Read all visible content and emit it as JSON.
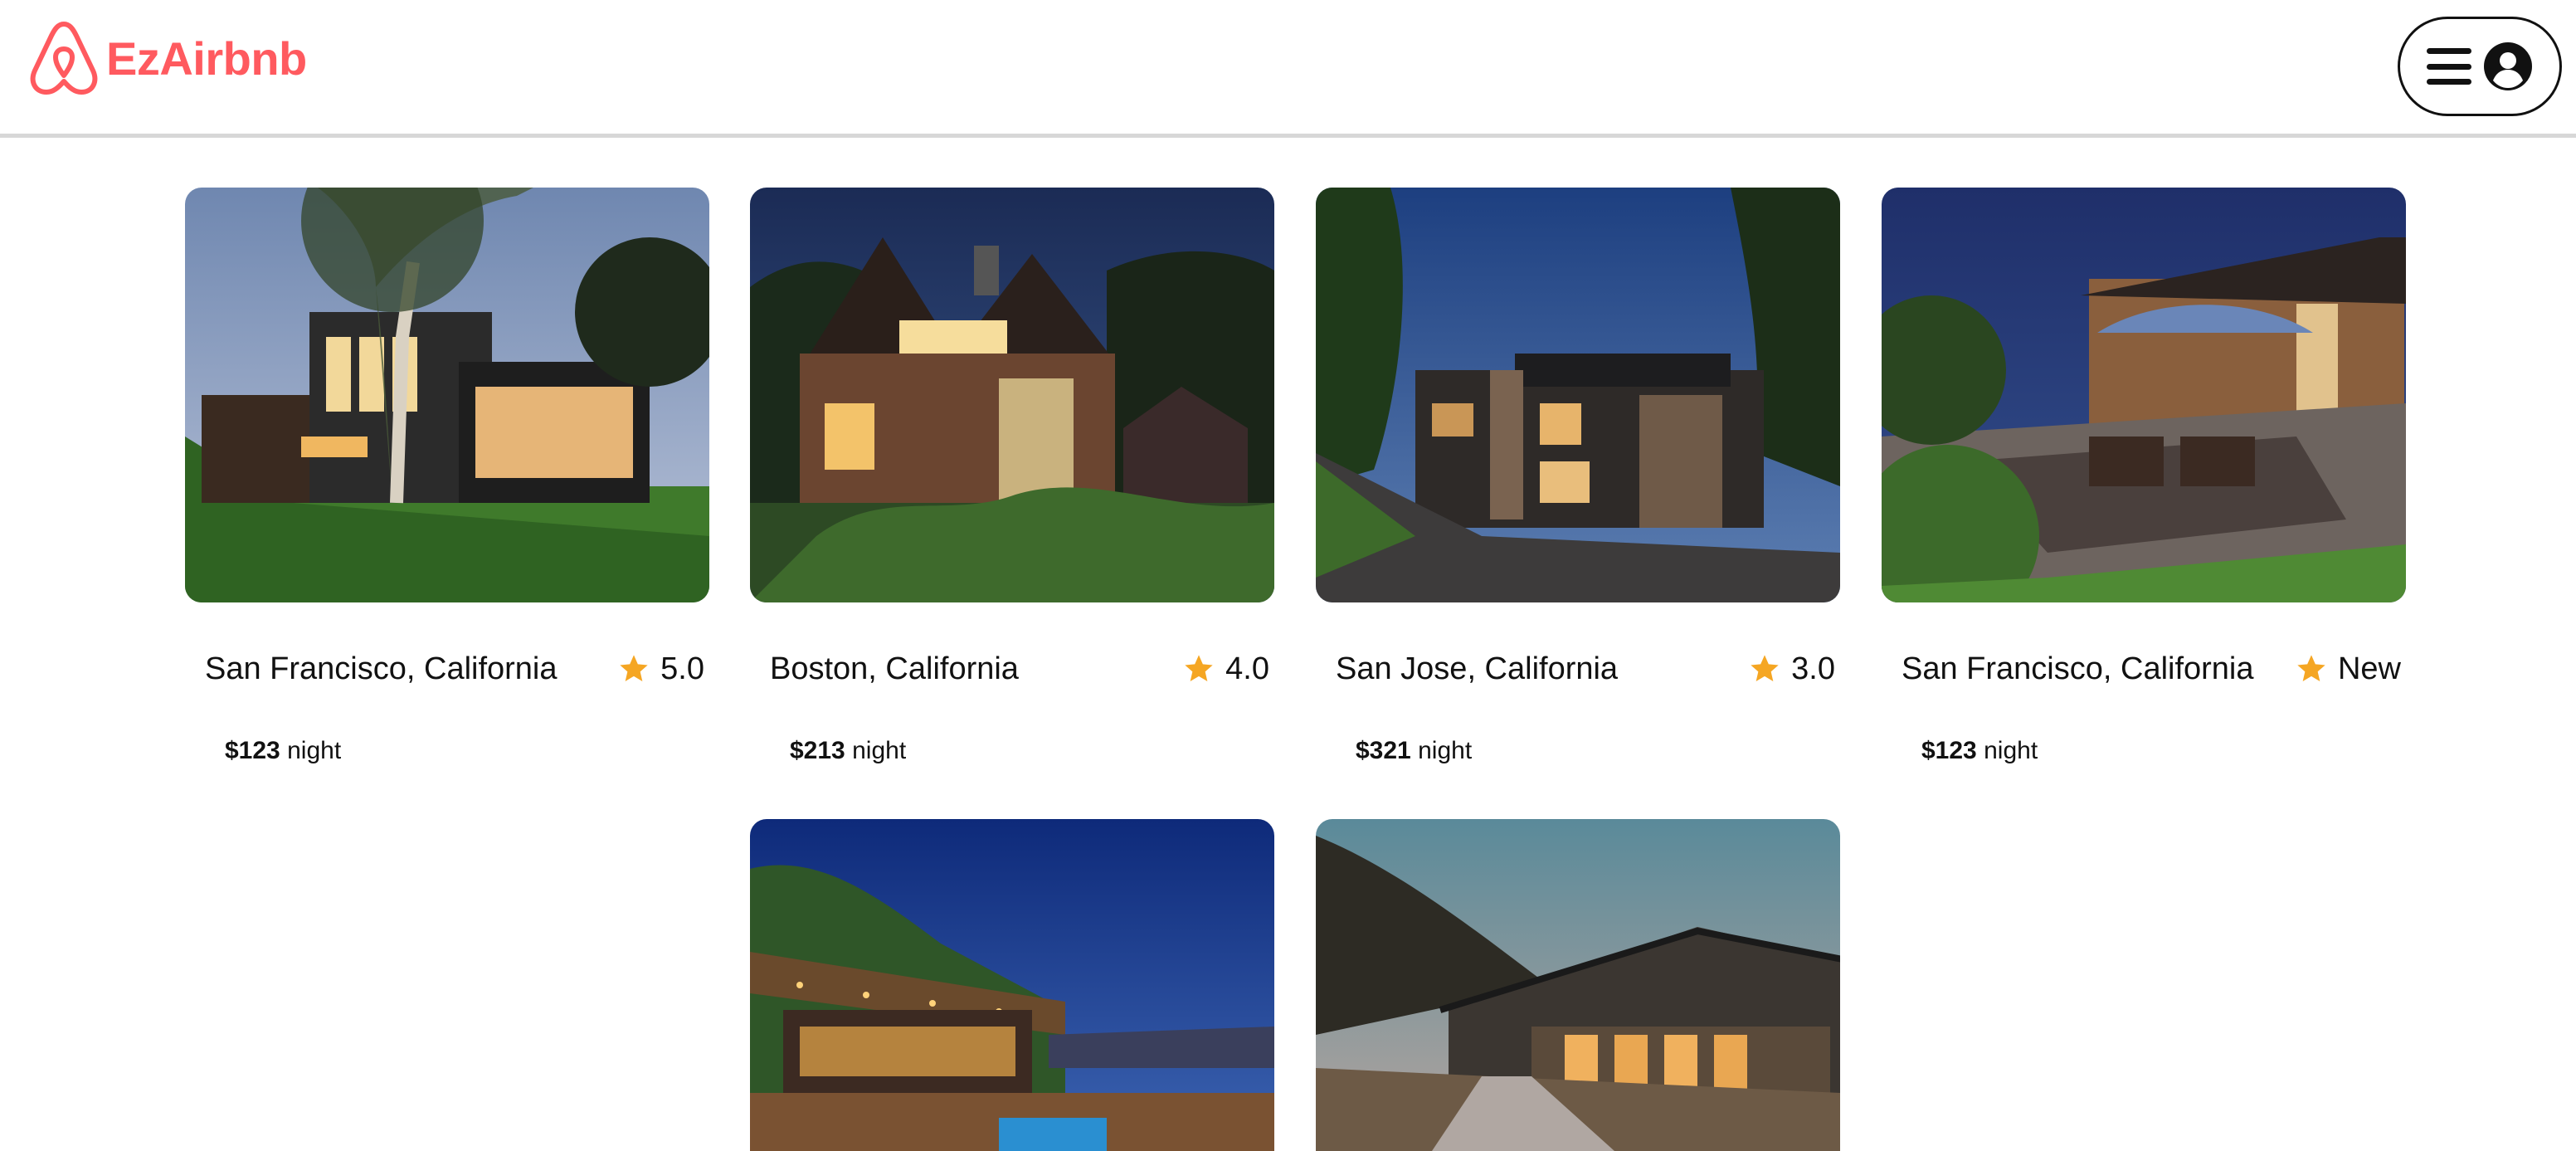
{
  "app": {
    "name": "EzAirbnb"
  },
  "colors": {
    "brand": "#ff5a5f",
    "star": "#f5a623",
    "divider": "#d7d7d7"
  },
  "header": {
    "logo_icon": "airbnb-logo-icon",
    "menu_icon": "hamburger-menu-icon",
    "profile_icon": "user-avatar-icon"
  },
  "listings": [
    {
      "location": "San Francisco, California",
      "rating": "5.0",
      "price": "$123",
      "unit": "night",
      "photo": "modern house at dusk with large tree"
    },
    {
      "location": "Boston, California",
      "rating": "4.0",
      "price": "$213",
      "unit": "night",
      "photo": "wooden gabled house at night"
    },
    {
      "location": "San Jose, California",
      "rating": "3.0",
      "price": "$321",
      "unit": "night",
      "photo": "stone villa on hillside at night"
    },
    {
      "location": "San Francisco, California",
      "rating": "New",
      "price": "$123",
      "unit": "night",
      "photo": "rooftop patio with umbrella at night"
    },
    {
      "photo": "pergola terrace with string lights and pool"
    },
    {
      "photo": "modern lodge with lit walkway at dusk"
    }
  ]
}
